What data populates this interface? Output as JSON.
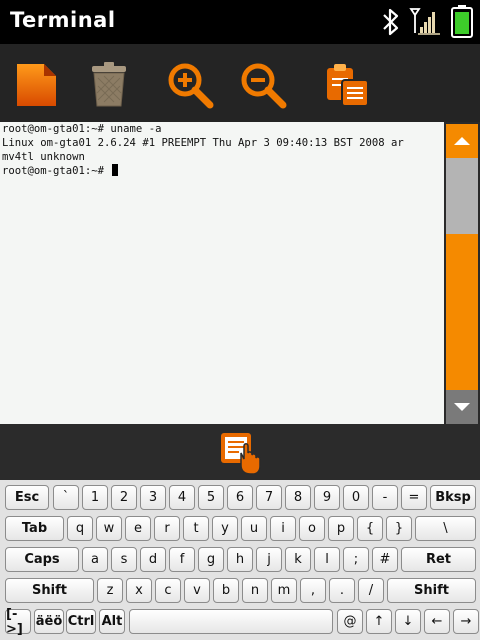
{
  "titlebar": {
    "title": "Terminal"
  },
  "toolbar": {
    "items": [
      {
        "name": "new-document-icon"
      },
      {
        "name": "trash-icon"
      },
      {
        "name": "zoom-in-icon"
      },
      {
        "name": "zoom-out-icon"
      },
      {
        "name": "clipboard-paste-icon"
      }
    ]
  },
  "terminal": {
    "lines": [
      "root@om-gta01:~# uname -a",
      "Linux om-gta01 2.6.24 #1 PREEMPT Thu Apr 3 09:40:13 BST 2008 ar",
      "mv4tl unknown",
      "root@om-gta01:~# "
    ]
  },
  "scrollbar": {
    "position": 0.63,
    "accent": "#f58a00"
  },
  "keyboard": {
    "rows": [
      [
        "Esc",
        "`",
        "1",
        "2",
        "3",
        "4",
        "5",
        "6",
        "7",
        "8",
        "9",
        "0",
        "-",
        "=",
        "Bksp"
      ],
      [
        "Tab",
        "q",
        "w",
        "e",
        "r",
        "t",
        "y",
        "u",
        "i",
        "o",
        "p",
        "{",
        "}",
        "\\"
      ],
      [
        "Caps",
        "a",
        "s",
        "d",
        "f",
        "g",
        "h",
        "j",
        "k",
        "l",
        ";",
        "#",
        "Ret"
      ],
      [
        "Shift",
        "z",
        "x",
        "c",
        "v",
        "b",
        "n",
        "m",
        ",",
        ".",
        "/",
        "Shift"
      ],
      [
        "[->]",
        "äëö",
        "Ctrl",
        "Alt",
        "",
        "@",
        "↑",
        "↓",
        "←",
        "→"
      ]
    ]
  },
  "colors": {
    "accent": "#f58a00",
    "titlebar": "#000000",
    "toolbar": "#242424"
  }
}
